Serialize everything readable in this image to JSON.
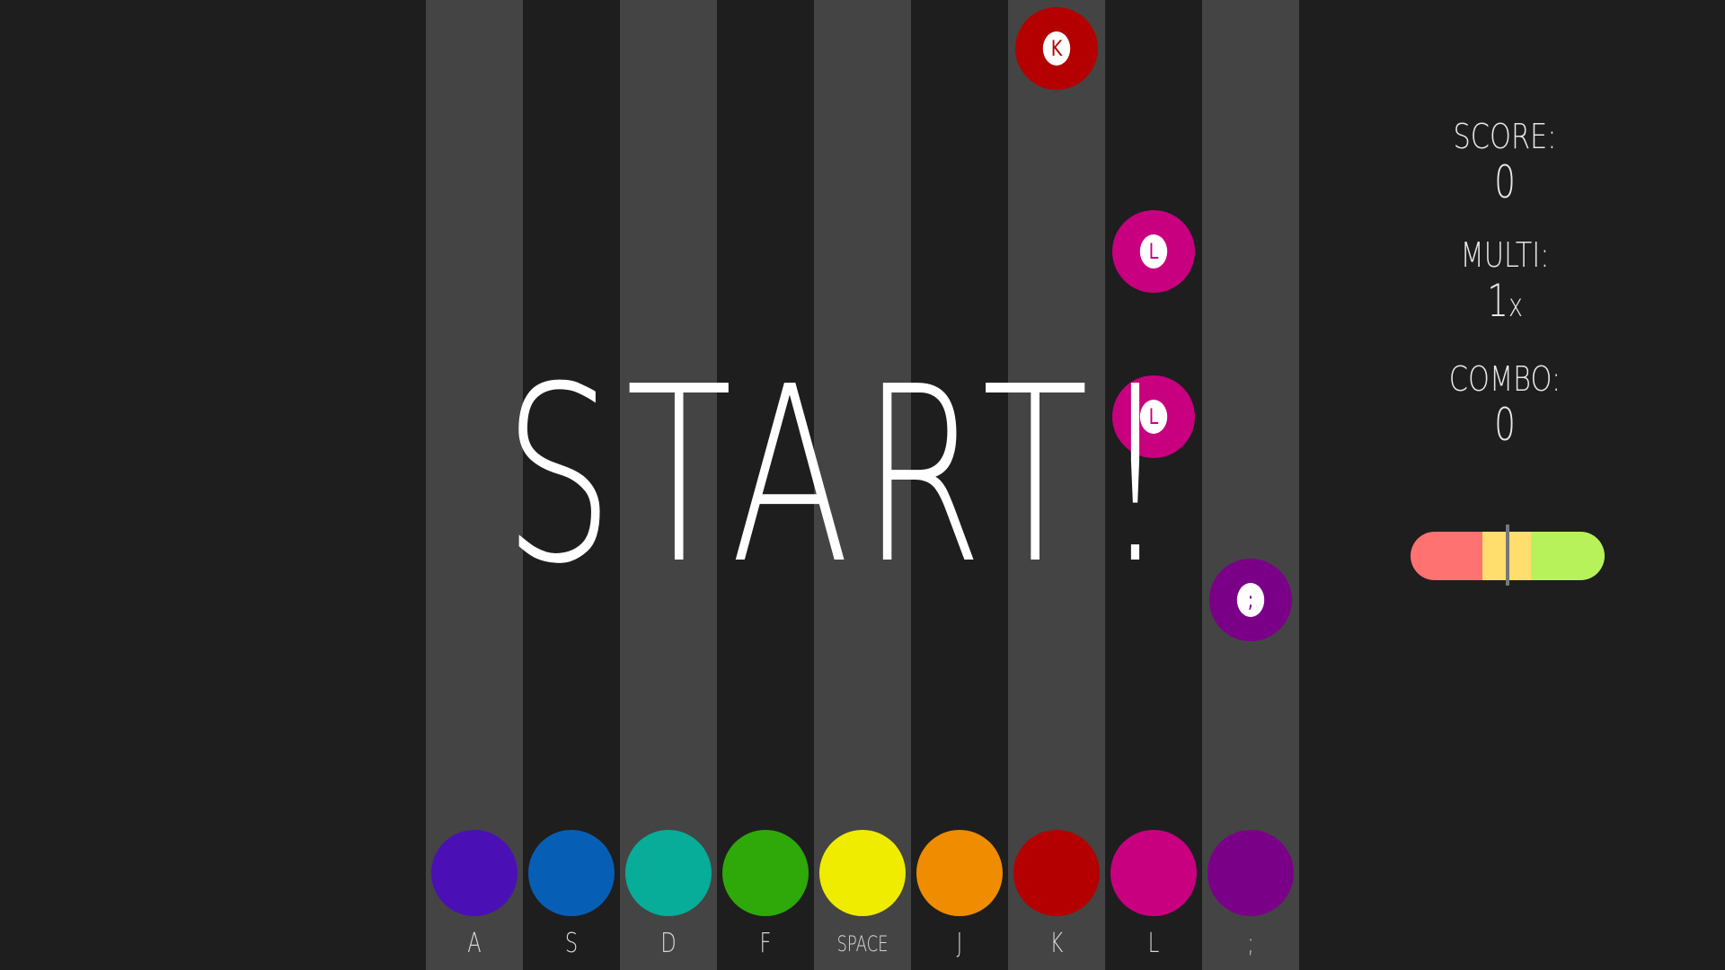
{
  "lanes": [
    {
      "key": "A",
      "color": "#4a10b5"
    },
    {
      "key": "S",
      "color": "#075fb5"
    },
    {
      "key": "D",
      "color": "#07ad98"
    },
    {
      "key": "F",
      "color": "#2fa80a"
    },
    {
      "key": "SPACE",
      "color": "#efec00"
    },
    {
      "key": "J",
      "color": "#ef8c00"
    },
    {
      "key": "K",
      "color": "#b40000"
    },
    {
      "key": "L",
      "color": "#c80080"
    },
    {
      "key": ";",
      "color": "#7a0088"
    }
  ],
  "notes": [
    {
      "lane": 6,
      "key": "K",
      "color": "#b40000"
    },
    {
      "lane": 7,
      "key": "L",
      "color": "#c80080"
    },
    {
      "lane": 7,
      "key": "L",
      "color": "#c80080"
    },
    {
      "lane": 8,
      "key": ";",
      "color": "#7a0088"
    }
  ],
  "banner": "START!",
  "hud": {
    "score_label": "SCORE:",
    "score": "0",
    "multi_label": "MULTI:",
    "multi_value": "1",
    "multi_unit": "x",
    "combo_label": "COMBO:",
    "combo": "0"
  },
  "timing_meter": {
    "colors": [
      "#ff7272",
      "#ffde6e",
      "#b8f25a"
    ]
  }
}
